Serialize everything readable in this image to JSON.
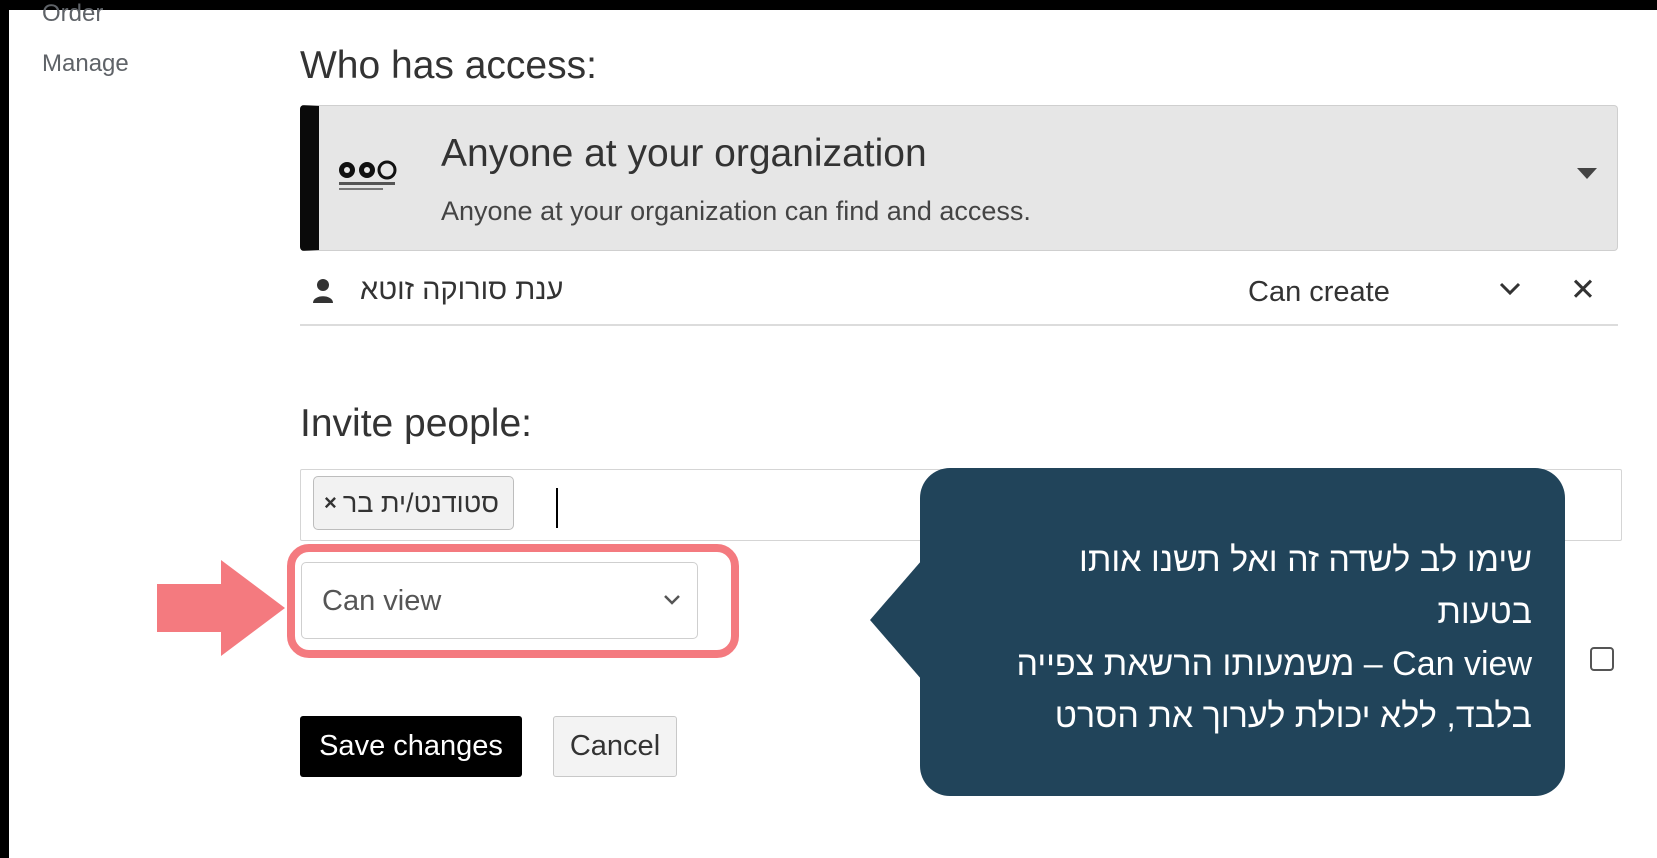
{
  "sidebar": {
    "items": [
      {
        "label": "Order"
      },
      {
        "label": "Manage"
      }
    ]
  },
  "access": {
    "title": "Who has access:",
    "option_title": "Anyone at your organization",
    "option_description": "Anyone at your organization can find and access.",
    "members": [
      {
        "name": "ענת סורוקה זוטא",
        "role": "Can create"
      }
    ]
  },
  "invite": {
    "title": "Invite people:",
    "tags": [
      {
        "label": "סטודנט/ית בר"
      }
    ],
    "permission_selected": "Can view"
  },
  "actions": {
    "save_label": "Save changes",
    "cancel_label": "Cancel"
  },
  "callout": {
    "lines": [
      "שימו לב לשדה זה ואל תשנו אותו",
      "בטעות",
      "Can view – משמעותו הרשאת צפייה",
      "בלבד, ללא יכולת לערוך את הסרט"
    ]
  },
  "colors": {
    "highlight": "#f47a7f",
    "callout_background": "#21445a",
    "dropdown_background": "#e6e6e6",
    "accent_dark": "#000000"
  },
  "icons": {
    "org_logo": "organization-logo",
    "member": "user-icon",
    "role_dropdown": "chevron-down-icon",
    "remove_member": "close-icon",
    "remove_tag": "close-icon",
    "pointer": "arrow-right-icon"
  }
}
